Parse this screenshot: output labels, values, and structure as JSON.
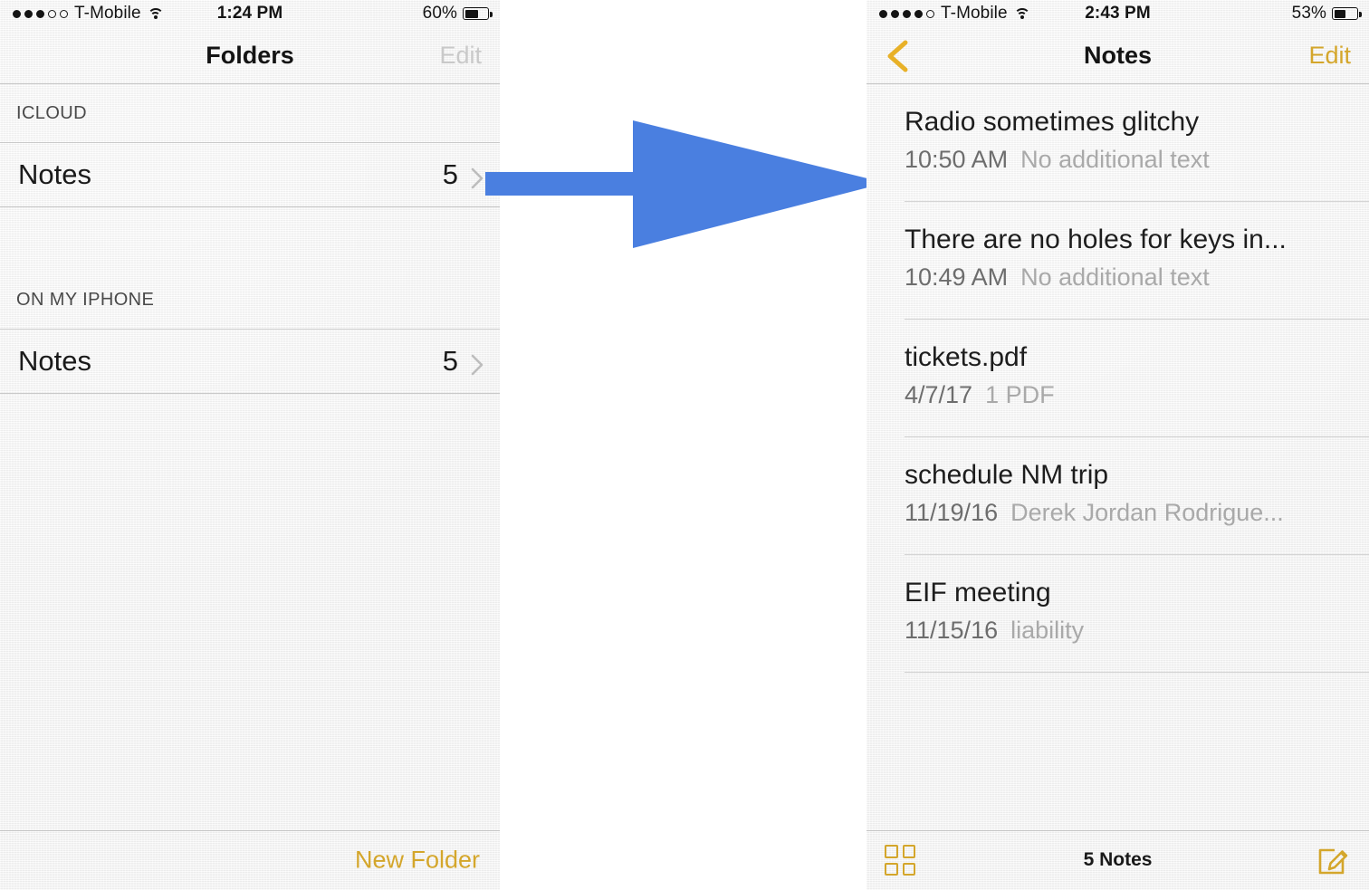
{
  "left_screen": {
    "status_bar": {
      "signal_filled": 3,
      "signal_total": 5,
      "carrier": "T-Mobile",
      "wifi_icon": "wifi-icon",
      "time": "1:24 PM",
      "battery_percent": "60%",
      "battery_level": 60
    },
    "nav": {
      "title": "Folders",
      "edit_label": "Edit",
      "edit_enabled": false
    },
    "sections": [
      {
        "header": "ICLOUD",
        "rows": [
          {
            "name": "Notes",
            "count": "5",
            "chevron_icon": "chevron-right-icon"
          }
        ]
      },
      {
        "header": "ON MY IPHONE",
        "rows": [
          {
            "name": "Notes",
            "count": "5",
            "chevron_icon": "chevron-right-icon"
          }
        ]
      }
    ],
    "toolbar": {
      "new_folder_label": "New Folder"
    }
  },
  "arrow": {
    "icon": "right-arrow-icon",
    "color": "#4a7fe0",
    "direction": "right"
  },
  "right_screen": {
    "status_bar": {
      "signal_filled": 4,
      "signal_total": 5,
      "carrier": "T-Mobile",
      "wifi_icon": "wifi-icon",
      "time": "2:43 PM",
      "battery_percent": "53%",
      "battery_level": 53
    },
    "nav": {
      "back_icon": "chevron-left-icon",
      "title": "Notes",
      "edit_label": "Edit",
      "edit_enabled": true
    },
    "notes": [
      {
        "title": "Radio sometimes glitchy",
        "date": "10:50 AM",
        "preview": "No additional text"
      },
      {
        "title": "There are no holes for keys in...",
        "date": "10:49 AM",
        "preview": "No additional text"
      },
      {
        "title": "tickets.pdf",
        "date": "4/7/17",
        "preview": "1 PDF"
      },
      {
        "title": "schedule NM trip",
        "date": "11/19/16",
        "preview": "Derek Jordan Rodrigue..."
      },
      {
        "title": "EIF meeting",
        "date": "11/15/16",
        "preview": "liability"
      }
    ],
    "toolbar": {
      "grid_icon": "grid-view-icon",
      "count_label": "5 Notes",
      "compose_icon": "compose-note-icon"
    }
  },
  "colors": {
    "accent_gold": "#d4a62b",
    "arrow_blue": "#4a7fe0",
    "paper_bg": "#f4f4f4",
    "title_text": "#1d1d1d",
    "date_text": "#6d6d6d",
    "preview_text": "#a9a9a9",
    "disabled_text": "#c9c9c9"
  }
}
